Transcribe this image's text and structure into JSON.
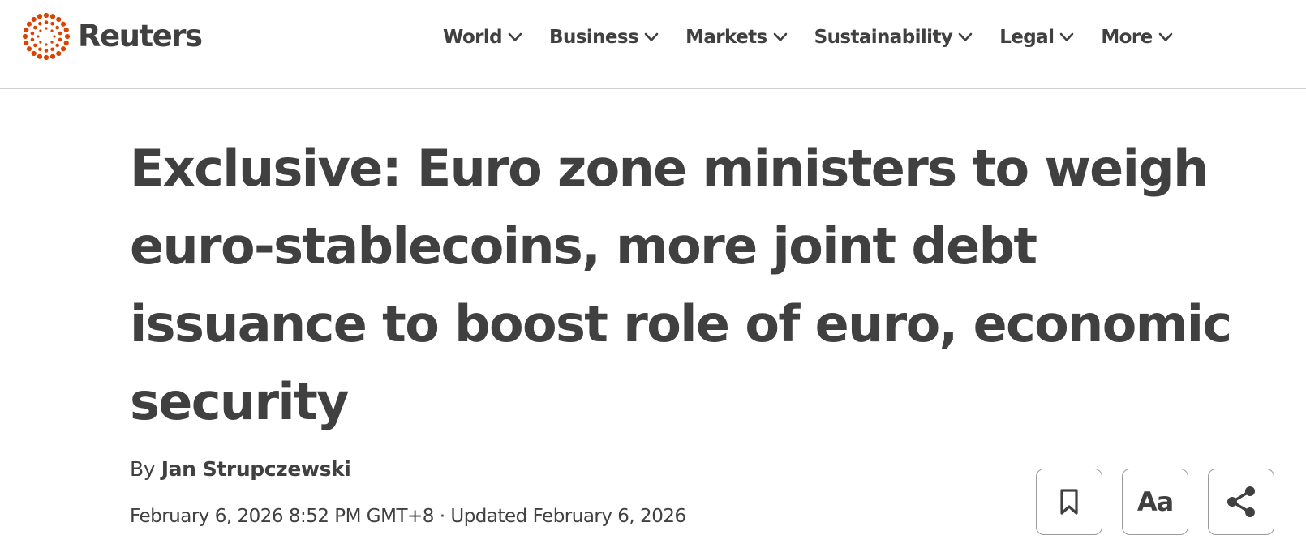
{
  "header": {
    "brand": {
      "name": "Reuters",
      "logo_icon": "reuters-dot-ring-logo",
      "logo_color": "#dc4300"
    },
    "nav": [
      {
        "label": "World",
        "icon": "chevron-down-icon"
      },
      {
        "label": "Business",
        "icon": "chevron-down-icon"
      },
      {
        "label": "Markets",
        "icon": "chevron-down-icon"
      },
      {
        "label": "Sustainability",
        "icon": "chevron-down-icon"
      },
      {
        "label": "Legal",
        "icon": "chevron-down-icon"
      },
      {
        "label": "More",
        "icon": "chevron-down-icon"
      }
    ]
  },
  "article": {
    "headline": "Exclusive: Euro zone ministers to weigh euro-stablecoins, more joint debt issuance to boost role of euro, economic security",
    "byline_prefix": "By",
    "author": "Jan Strupczewski",
    "dateline": "February 6, 2026 8:52 PM GMT+8 · Updated February 6, 2026"
  },
  "tools": {
    "bookmark_icon": "bookmark-icon",
    "text_size_label": "Aa",
    "share_icon": "share-icon"
  },
  "colors": {
    "text": "#404040",
    "brand_accent": "#dc4300",
    "divider": "#d0d0d0"
  }
}
